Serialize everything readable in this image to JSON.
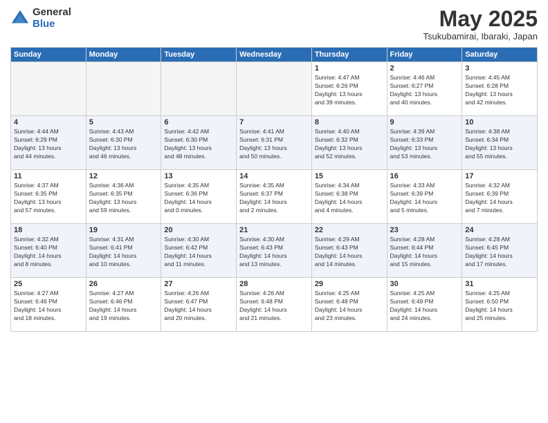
{
  "logo": {
    "general": "General",
    "blue": "Blue"
  },
  "title": {
    "month": "May 2025",
    "location": "Tsukubamirai, Ibaraki, Japan"
  },
  "headers": [
    "Sunday",
    "Monday",
    "Tuesday",
    "Wednesday",
    "Thursday",
    "Friday",
    "Saturday"
  ],
  "weeks": [
    [
      {
        "day": "",
        "info": "",
        "empty": true
      },
      {
        "day": "",
        "info": "",
        "empty": true
      },
      {
        "day": "",
        "info": "",
        "empty": true
      },
      {
        "day": "",
        "info": "",
        "empty": true
      },
      {
        "day": "1",
        "info": "Sunrise: 4:47 AM\nSunset: 6:26 PM\nDaylight: 13 hours\nand 39 minutes.",
        "empty": false
      },
      {
        "day": "2",
        "info": "Sunrise: 4:46 AM\nSunset: 6:27 PM\nDaylight: 13 hours\nand 40 minutes.",
        "empty": false
      },
      {
        "day": "3",
        "info": "Sunrise: 4:45 AM\nSunset: 6:28 PM\nDaylight: 13 hours\nand 42 minutes.",
        "empty": false
      }
    ],
    [
      {
        "day": "4",
        "info": "Sunrise: 4:44 AM\nSunset: 6:29 PM\nDaylight: 13 hours\nand 44 minutes.",
        "empty": false
      },
      {
        "day": "5",
        "info": "Sunrise: 4:43 AM\nSunset: 6:30 PM\nDaylight: 13 hours\nand 46 minutes.",
        "empty": false
      },
      {
        "day": "6",
        "info": "Sunrise: 4:42 AM\nSunset: 6:30 PM\nDaylight: 13 hours\nand 48 minutes.",
        "empty": false
      },
      {
        "day": "7",
        "info": "Sunrise: 4:41 AM\nSunset: 6:31 PM\nDaylight: 13 hours\nand 50 minutes.",
        "empty": false
      },
      {
        "day": "8",
        "info": "Sunrise: 4:40 AM\nSunset: 6:32 PM\nDaylight: 13 hours\nand 52 minutes.",
        "empty": false
      },
      {
        "day": "9",
        "info": "Sunrise: 4:39 AM\nSunset: 6:33 PM\nDaylight: 13 hours\nand 53 minutes.",
        "empty": false
      },
      {
        "day": "10",
        "info": "Sunrise: 4:38 AM\nSunset: 6:34 PM\nDaylight: 13 hours\nand 55 minutes.",
        "empty": false
      }
    ],
    [
      {
        "day": "11",
        "info": "Sunrise: 4:37 AM\nSunset: 6:35 PM\nDaylight: 13 hours\nand 57 minutes.",
        "empty": false
      },
      {
        "day": "12",
        "info": "Sunrise: 4:36 AM\nSunset: 6:35 PM\nDaylight: 13 hours\nand 59 minutes.",
        "empty": false
      },
      {
        "day": "13",
        "info": "Sunrise: 4:35 AM\nSunset: 6:36 PM\nDaylight: 14 hours\nand 0 minutes.",
        "empty": false
      },
      {
        "day": "14",
        "info": "Sunrise: 4:35 AM\nSunset: 6:37 PM\nDaylight: 14 hours\nand 2 minutes.",
        "empty": false
      },
      {
        "day": "15",
        "info": "Sunrise: 4:34 AM\nSunset: 6:38 PM\nDaylight: 14 hours\nand 4 minutes.",
        "empty": false
      },
      {
        "day": "16",
        "info": "Sunrise: 4:33 AM\nSunset: 6:39 PM\nDaylight: 14 hours\nand 5 minutes.",
        "empty": false
      },
      {
        "day": "17",
        "info": "Sunrise: 4:32 AM\nSunset: 6:39 PM\nDaylight: 14 hours\nand 7 minutes.",
        "empty": false
      }
    ],
    [
      {
        "day": "18",
        "info": "Sunrise: 4:32 AM\nSunset: 6:40 PM\nDaylight: 14 hours\nand 8 minutes.",
        "empty": false
      },
      {
        "day": "19",
        "info": "Sunrise: 4:31 AM\nSunset: 6:41 PM\nDaylight: 14 hours\nand 10 minutes.",
        "empty": false
      },
      {
        "day": "20",
        "info": "Sunrise: 4:30 AM\nSunset: 6:42 PM\nDaylight: 14 hours\nand 11 minutes.",
        "empty": false
      },
      {
        "day": "21",
        "info": "Sunrise: 4:30 AM\nSunset: 6:43 PM\nDaylight: 14 hours\nand 13 minutes.",
        "empty": false
      },
      {
        "day": "22",
        "info": "Sunrise: 4:29 AM\nSunset: 6:43 PM\nDaylight: 14 hours\nand 14 minutes.",
        "empty": false
      },
      {
        "day": "23",
        "info": "Sunrise: 4:28 AM\nSunset: 6:44 PM\nDaylight: 14 hours\nand 15 minutes.",
        "empty": false
      },
      {
        "day": "24",
        "info": "Sunrise: 4:28 AM\nSunset: 6:45 PM\nDaylight: 14 hours\nand 17 minutes.",
        "empty": false
      }
    ],
    [
      {
        "day": "25",
        "info": "Sunrise: 4:27 AM\nSunset: 6:46 PM\nDaylight: 14 hours\nand 18 minutes.",
        "empty": false
      },
      {
        "day": "26",
        "info": "Sunrise: 4:27 AM\nSunset: 6:46 PM\nDaylight: 14 hours\nand 19 minutes.",
        "empty": false
      },
      {
        "day": "27",
        "info": "Sunrise: 4:26 AM\nSunset: 6:47 PM\nDaylight: 14 hours\nand 20 minutes.",
        "empty": false
      },
      {
        "day": "28",
        "info": "Sunrise: 4:26 AM\nSunset: 6:48 PM\nDaylight: 14 hours\nand 21 minutes.",
        "empty": false
      },
      {
        "day": "29",
        "info": "Sunrise: 4:25 AM\nSunset: 6:48 PM\nDaylight: 14 hours\nand 23 minutes.",
        "empty": false
      },
      {
        "day": "30",
        "info": "Sunrise: 4:25 AM\nSunset: 6:49 PM\nDaylight: 14 hours\nand 24 minutes.",
        "empty": false
      },
      {
        "day": "31",
        "info": "Sunrise: 4:25 AM\nSunset: 6:50 PM\nDaylight: 14 hours\nand 25 minutes.",
        "empty": false
      }
    ]
  ]
}
